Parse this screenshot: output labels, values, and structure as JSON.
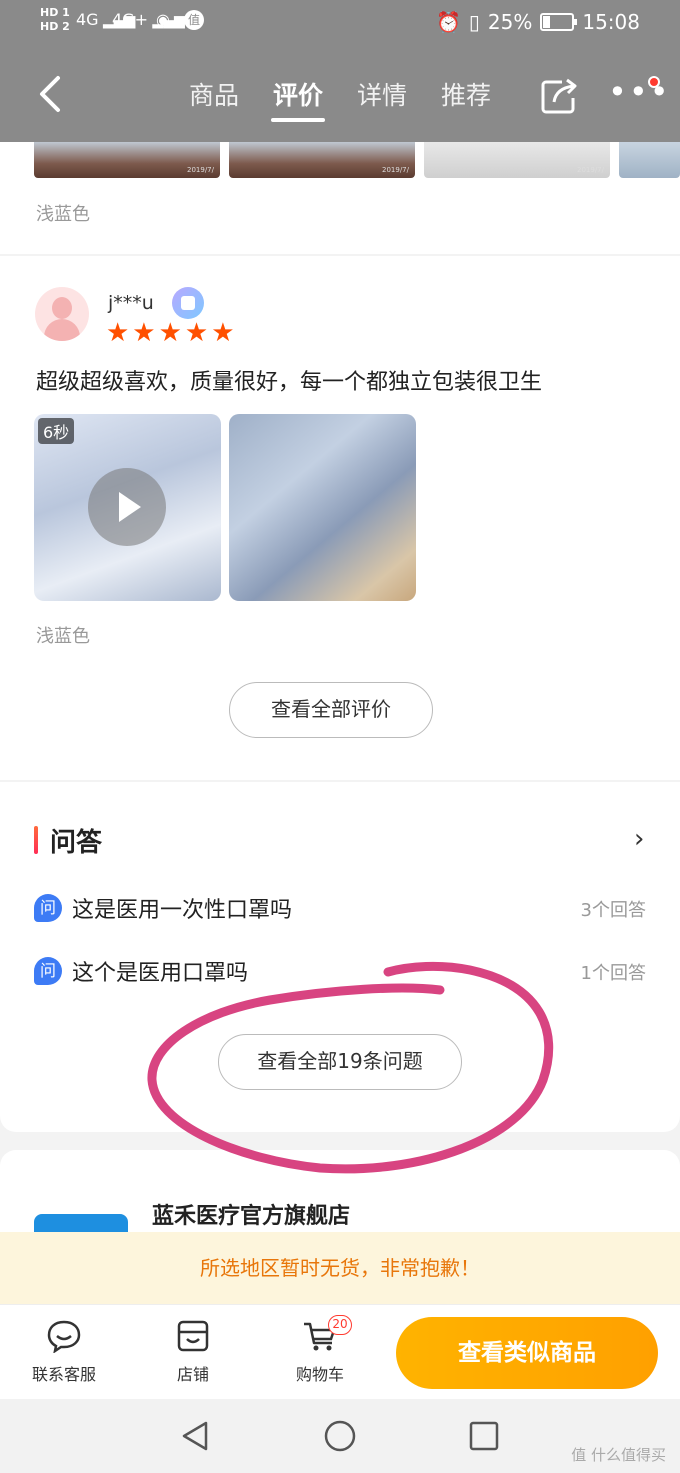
{
  "status_bar": {
    "network_labels": [
      "HD 1",
      "HD 2"
    ],
    "signal_1": "4G",
    "signal_2": "4G+",
    "app_badge": "值",
    "battery_text": "25%",
    "battery_level": 0.25,
    "time": "15:08"
  },
  "header": {
    "tabs": [
      {
        "label": "商品",
        "active": false
      },
      {
        "label": "评价",
        "active": true
      },
      {
        "label": "详情",
        "active": false
      },
      {
        "label": "推荐",
        "active": false
      }
    ]
  },
  "prev_review": {
    "photo_dates": [
      "2019/7/",
      "2019/7/",
      "2019/7/"
    ],
    "color_label": "浅蓝色"
  },
  "review": {
    "username": "j***u",
    "rating": 5,
    "stars": "★★★★★",
    "text": "超级超级喜欢，质量很好，每一个都独立包装很卫生",
    "video_duration": "6秒",
    "color_label": "浅蓝色",
    "view_all_label": "查看全部评价"
  },
  "qa": {
    "title": "问答",
    "icon_char": "问",
    "items": [
      {
        "question": "这是医用一次性口罩吗",
        "count": "3个回答"
      },
      {
        "question": "这个是医用口罩吗",
        "count": "1个回答"
      }
    ],
    "view_all_label": "查看全部19条问题"
  },
  "store": {
    "name": "蓝禾医疗官方旗舰店"
  },
  "notice": "所选地区暂时无货，非常抱歉！",
  "bottom_bar": {
    "service_label": "联系客服",
    "shop_label": "店铺",
    "cart_label": "购物车",
    "cart_count": "20",
    "similar_label": "查看类似商品"
  },
  "watermark": "值 什么值得买",
  "colors": {
    "header_bg": "#8a8a8a",
    "accent": "#ff5000",
    "cta": "#ffa800",
    "annotation": "#d63a7a",
    "qa_icon": "#3d7bf5"
  }
}
